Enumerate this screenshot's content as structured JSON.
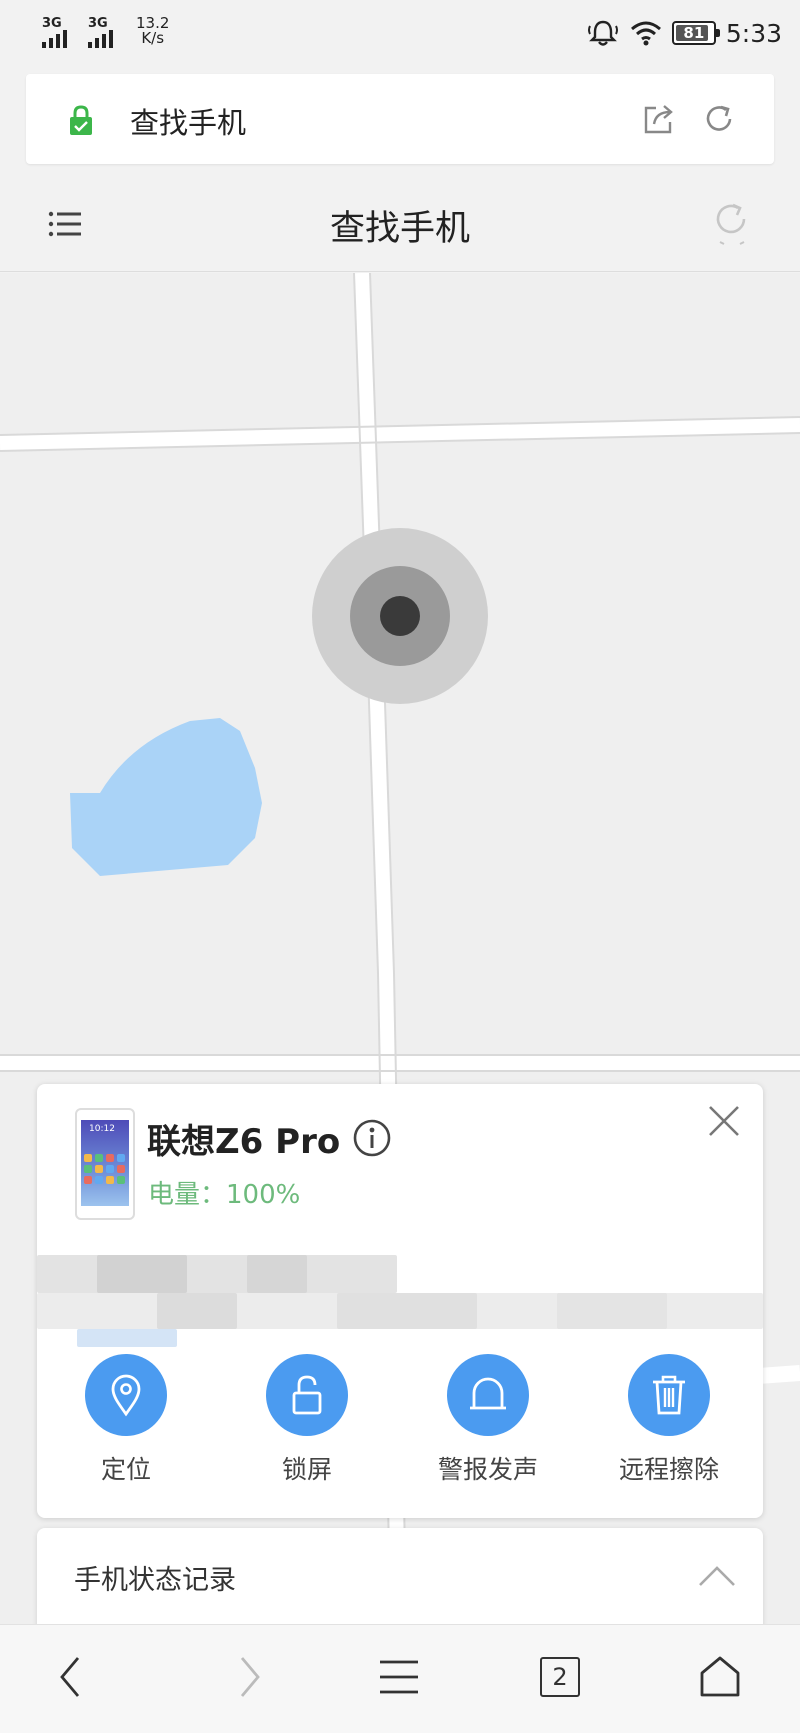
{
  "status_bar": {
    "signal1_label": "3G",
    "signal2_label": "3G",
    "speed_value": "13.2",
    "speed_unit": "K/s",
    "battery_level": "81",
    "time": "5:33",
    "icons": [
      "alarm-bell-icon",
      "wifi-icon",
      "battery-icon"
    ]
  },
  "browser": {
    "url_title": "查找手机",
    "secure": true,
    "lock_color": "#3cb64a",
    "icons": [
      "lock-icon",
      "share-icon",
      "reload-icon"
    ]
  },
  "app": {
    "title": "查找手机",
    "icons": [
      "menu-icon",
      "refresh-icon"
    ]
  },
  "map": {
    "water_color": "#aad3f7",
    "location_marker": "gray-radius-dot"
  },
  "device_card": {
    "device_name": "联想Z6 Pro",
    "battery_text": "电量：100%",
    "battery_color": "#6dba7c",
    "thumb_time": "10:12",
    "address_blurred": true,
    "actions": [
      {
        "label": "定位",
        "icon": "location-pin-icon"
      },
      {
        "label": "锁屏",
        "icon": "unlock-icon"
      },
      {
        "label": "警报发声",
        "icon": "bell-icon"
      },
      {
        "label": "远程擦除",
        "icon": "trash-icon"
      }
    ],
    "accent_color": "#4b9bf0"
  },
  "status_record": {
    "title": "手机状态记录",
    "expanded": true
  },
  "bottom_nav": {
    "tab_count": "2",
    "icons": [
      "back-icon",
      "forward-icon",
      "menu-lines-icon",
      "tabs-icon",
      "home-icon"
    ]
  }
}
